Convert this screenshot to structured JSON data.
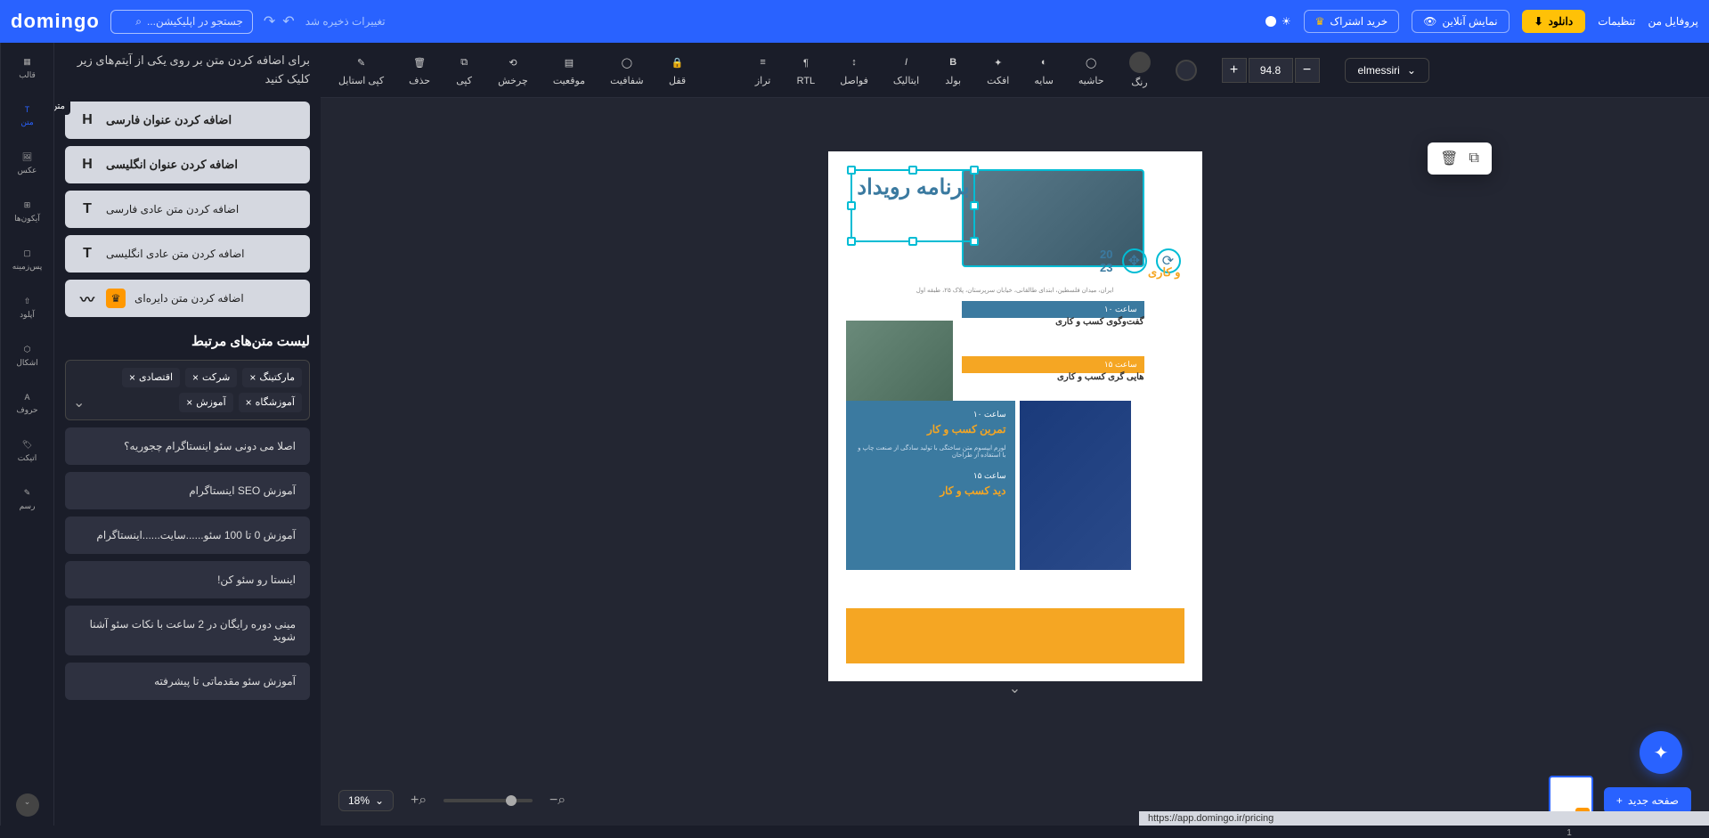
{
  "header": {
    "profile": "پروفایل من",
    "settings": "تنظیمات",
    "download": "دانلود",
    "preview": "نمایش آنلاین",
    "buy": "خرید اشتراک",
    "saved": "تغییرات ذخیره شد",
    "search_placeholder": "جستجو در اپلیکیشن...",
    "logo": "domingo"
  },
  "toolbar": {
    "copy_style": "کپی استایل",
    "delete": "حذف",
    "copy": "کپی",
    "rotate": "چرخش",
    "position": "موقعیت",
    "opacity": "شفافیت",
    "lock": "قفل",
    "align": "تراز",
    "rtl": "RTL",
    "spacing": "فواصل",
    "italic": "ایتالیک",
    "bold": "بولد",
    "effect": "افکت",
    "shadow": "سایه",
    "border": "حاشیه",
    "color": "رنگ",
    "font_size": "94.8",
    "font_name": "elmessiri"
  },
  "nav": {
    "template": "قالب",
    "text": "متن",
    "image": "عکس",
    "icons": "آیکون‌ها",
    "background": "پس‌زمینه",
    "upload": "آپلود",
    "shapes": "اشکال",
    "fonts": "حروف",
    "ticket": "اتیکت",
    "draw": "رسم"
  },
  "sidebar": {
    "hint": "برای اضافه کردن متن بر روی یکی از آیتم‌های زیر کلیک کنید",
    "pill_text": "متن",
    "add_fa_title": "اضافه کردن عنوان فارسی",
    "add_en_title": "اضافه کردن عنوان انگلیسی",
    "add_fa_text": "اضافه کردن متن عادی فارسی",
    "add_en_text": "اضافه کردن متن عادی انگلیسی",
    "add_circle": "اضافه کردن متن دایره‌ای",
    "list_title": "لیست متن‌های مرتبط",
    "tags": [
      "مارکتینگ",
      "شرکت",
      "اقتصادی",
      "آموزشگاه",
      "آموزش"
    ],
    "suggestions": [
      "اصلا می دونی سئو اینستاگرام چجوریه؟",
      "آموزش SEO اینستاگرام",
      "آموزش 0 تا 100 سئو......سایت......اینستاگرام",
      "اینستا رو سئو کن!",
      "مینی دوره رایگان در 2 ساعت با نکات سئو آشنا شوید",
      "آموزش سئو مقدماتی تا پیشرفته"
    ]
  },
  "canvas": {
    "sel_text": "برنامه رویداد",
    "sub1": "20\n23",
    "sub2": "و کاری",
    "bar1": "ساعت ۱۰",
    "row1_title": "گفت‌وگوی کسب و کاری",
    "bar2": "ساعت ۱۵",
    "row2_title": "هایی گری کسب و کاری",
    "blue_bar1": "ساعت ۱۰",
    "blue_t1": "تمرین کسب و کار",
    "blue_bar2": "ساعت ۱۵",
    "blue_t2": "دید کسب و کار"
  },
  "bottom": {
    "zoom": "18%",
    "new_page": "صفحه جدید",
    "page_num": "1"
  },
  "status_url": "https://app.domingo.ir/pricing"
}
